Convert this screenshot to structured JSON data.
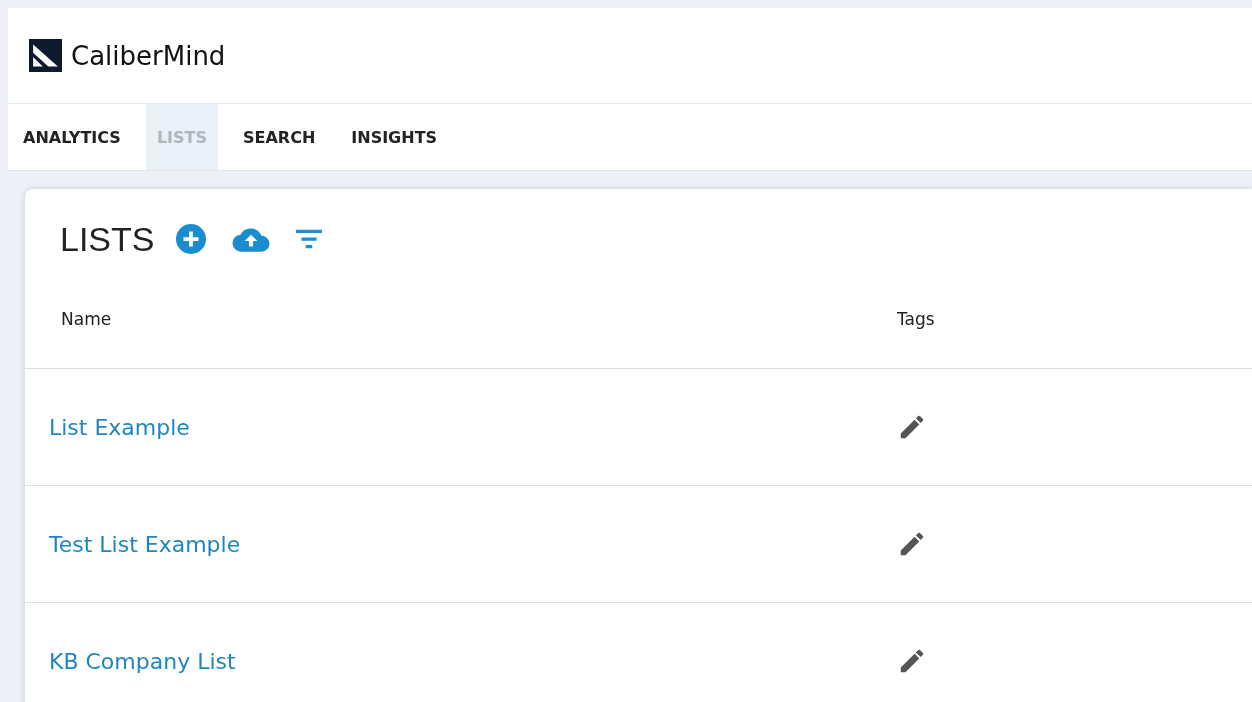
{
  "app": {
    "name": "CaliberMind"
  },
  "tabs": [
    {
      "label": "ANALYTICS",
      "selected": false
    },
    {
      "label": "LISTS",
      "selected": true
    },
    {
      "label": "SEARCH",
      "selected": false
    },
    {
      "label": "INSIGHTS",
      "selected": false
    }
  ],
  "panel": {
    "title": "LISTS"
  },
  "table": {
    "columns": [
      "Name",
      "Tags"
    ],
    "rows": [
      {
        "name": "List Example"
      },
      {
        "name": "Test List Example"
      },
      {
        "name": "KB Company List"
      }
    ]
  }
}
